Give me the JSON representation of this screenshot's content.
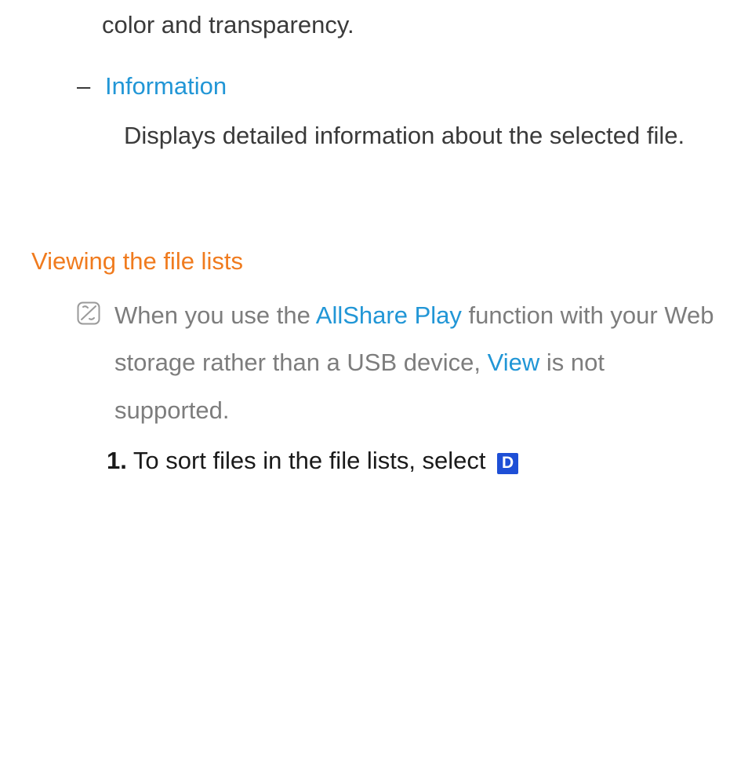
{
  "top_fragment": "color and transparency.",
  "list_item": {
    "dash": "–",
    "title": "Information",
    "body": "Displays detailed information about the selected file."
  },
  "section_heading": "Viewing the file lists",
  "note": {
    "pre": "When you use the ",
    "allshare": "AllShare Play",
    "mid": " function with your Web storage rather than a USB device, ",
    "view": "View",
    "post": " is not supported."
  },
  "step1": {
    "num": "1.",
    "text": "To sort files in the file lists, select ",
    "badge": "D"
  },
  "icons": {
    "note": "note-icon",
    "d_button": "d-button-icon"
  }
}
